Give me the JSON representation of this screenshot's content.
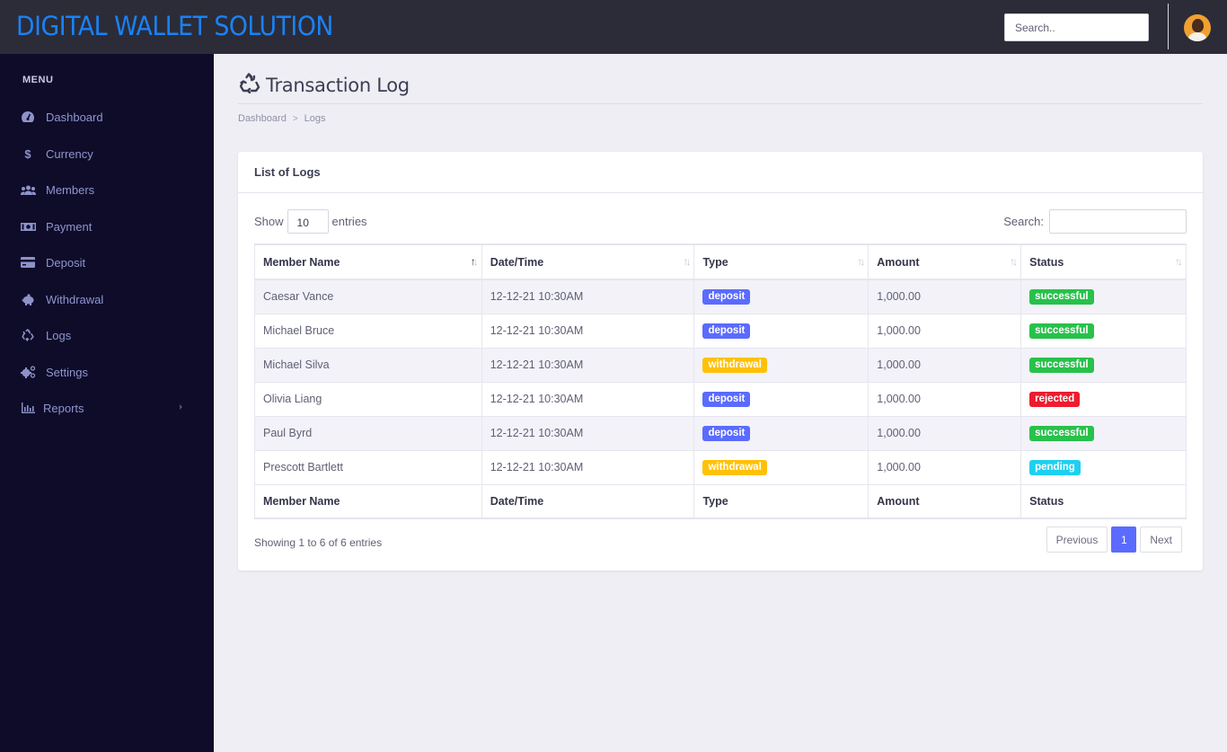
{
  "app": {
    "brand": "DIGITAL WALLET SOLUTION",
    "search_placeholder": "Search..",
    "brand_color": "#1a82f7"
  },
  "sidebar": {
    "menu_title": "MENU",
    "items": [
      {
        "label": "Dashboard",
        "icon": "tachometer-icon"
      },
      {
        "label": "Currency",
        "icon": "dollar-icon"
      },
      {
        "label": "Members",
        "icon": "users-icon"
      },
      {
        "label": "Payment",
        "icon": "money-bill-icon"
      },
      {
        "label": "Deposit",
        "icon": "credit-card-icon"
      },
      {
        "label": "Withdrawal",
        "icon": "piggy-bank-icon"
      },
      {
        "label": "Logs",
        "icon": "recycle-icon"
      },
      {
        "label": "Settings",
        "icon": "cogs-icon"
      },
      {
        "label": "Reports",
        "icon": "bar-chart-icon",
        "has_submenu": true
      }
    ]
  },
  "page": {
    "title": "Transaction Log",
    "title_icon": "recycle-icon",
    "breadcrumb": [
      "Dashboard",
      "Logs"
    ]
  },
  "card": {
    "title": "List of Logs",
    "show_label": "Show",
    "entries_label": "entries",
    "page_length": "10",
    "search_label": "Search:",
    "search_value": ""
  },
  "table": {
    "columns": [
      "Member Name",
      "Date/Time",
      "Type",
      "Amount",
      "Status"
    ],
    "sorted_column": "Member Name",
    "rows": [
      {
        "member": "Caesar Vance",
        "datetime": "12-12-21 10:30AM",
        "type": "deposit",
        "amount": "1,000.00",
        "status": "successful"
      },
      {
        "member": "Michael Bruce",
        "datetime": "12-12-21 10:30AM",
        "type": "deposit",
        "amount": "1,000.00",
        "status": "successful"
      },
      {
        "member": "Michael Silva",
        "datetime": "12-12-21 10:30AM",
        "type": "withdrawal",
        "amount": "1,000.00",
        "status": "successful"
      },
      {
        "member": "Olivia Liang",
        "datetime": "12-12-21 10:30AM",
        "type": "deposit",
        "amount": "1,000.00",
        "status": "rejected"
      },
      {
        "member": "Paul Byrd",
        "datetime": "12-12-21 10:30AM",
        "type": "deposit",
        "amount": "1,000.00",
        "status": "successful"
      },
      {
        "member": "Prescott Bartlett",
        "datetime": "12-12-21 10:30AM",
        "type": "withdrawal",
        "amount": "1,000.00",
        "status": "pending"
      }
    ],
    "badge_colors": {
      "deposit": "#5b6bff",
      "withdrawal": "#ffc107",
      "successful": "#28c14b",
      "rejected": "#ee1c2f",
      "pending": "#1ed0f0"
    }
  },
  "footer": {
    "info": "Showing 1 to 6 of 6 entries",
    "previous": "Previous",
    "current_page": "1",
    "next": "Next"
  }
}
